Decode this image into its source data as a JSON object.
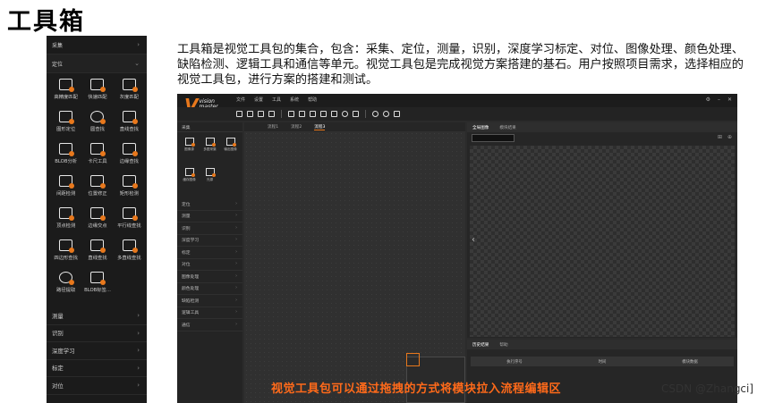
{
  "page_title": "工具箱",
  "toolbox": {
    "top_category": "采集",
    "expanded_category": "定位",
    "tools": [
      "高精度匹配",
      "快速匹配",
      "灰度匹配",
      "图形定位",
      "圆查找",
      "直线查找",
      "BLOB分析",
      "卡尺工具",
      "边缘查找",
      "间距检测",
      "位置修正",
      "矩形检测",
      "顶点检测",
      "边缘交点",
      "平行线查找",
      "四边形查找",
      "直线查找",
      "多直线查找",
      "路径提取",
      "BLOB标签..."
    ],
    "bottom_categories": [
      "测量",
      "识别",
      "深度学习",
      "标定",
      "对位"
    ]
  },
  "description": "工具箱是视觉工具包的集合，包含：采集、定位，测量，识别，深度学习标定、对位、图像处理、颜色处理、缺陷检测、逻辑工具和通信等单元。视觉工具包是完成视觉方案搭建的基石。用户按照项目需求，选择相应的视觉工具包，进行方案的搭建和测试。",
  "app": {
    "logo_letter": "V",
    "logo_word1": "vision",
    "logo_word2": "master",
    "menu": [
      "文件",
      "设置",
      "工具",
      "系统",
      "帮助"
    ],
    "sidebar_head": "采集",
    "sidebar_tools": [
      "图像源",
      "多图采集",
      "输出图像",
      "缓存图像",
      "光源"
    ],
    "sidebar_categories": [
      "定位",
      "测量",
      "识别",
      "深度学习",
      "标定",
      "对位",
      "图像处理",
      "颜色处理",
      "缺陷检测",
      "逻辑工具",
      "通信"
    ],
    "flow_tabs": [
      "流程1",
      "流程2",
      "流程3"
    ],
    "image_tabs": [
      "全局图像",
      "模块结果"
    ],
    "result_tabs": [
      "历史结果",
      "帮助"
    ],
    "result_headers": [
      "执行序号",
      "时间",
      "模块数据"
    ]
  },
  "caption": "视觉工具包可以通过拖拽的方式将模块拉入流程编辑区",
  "watermark": "CSDN @Zhangci]"
}
